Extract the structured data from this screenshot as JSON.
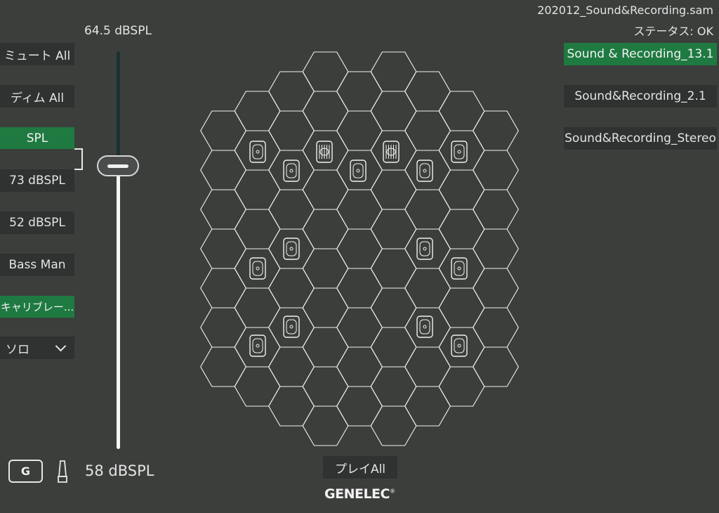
{
  "header": {
    "file_name": "202012_Sound&Recording.sam",
    "status": "ステータス: OK"
  },
  "left_panel": {
    "mute_all": "ミュート All",
    "dim_all": "ディム All",
    "spl": "SPL",
    "preset_73": "73 dBSPL",
    "preset_52": "52 dBSPL",
    "bass_man": "Bass Man",
    "calibration": "キャリブレー...",
    "solo": "ソロ"
  },
  "level": {
    "max_label": "64.5 dBSPL",
    "current_label": "58 dBSPL"
  },
  "presets": [
    {
      "label": "Sound & Recording_13.1",
      "active": true
    },
    {
      "label": "Sound&Recording_2.1",
      "active": false
    },
    {
      "label": "Sound&Recording_Stereo",
      "active": false
    }
  ],
  "bottom": {
    "play_all": "プレイAll",
    "g_label": "G",
    "brand": "GENELEC",
    "brand_mark": "®"
  },
  "colors": {
    "background": "#3b3e3b",
    "button": "#2f3230",
    "active": "#1f7a41"
  },
  "icons": {
    "speaker": "speaker-icon",
    "subwoofer": "subwoofer-icon",
    "bottle": "level-meter-icon"
  }
}
